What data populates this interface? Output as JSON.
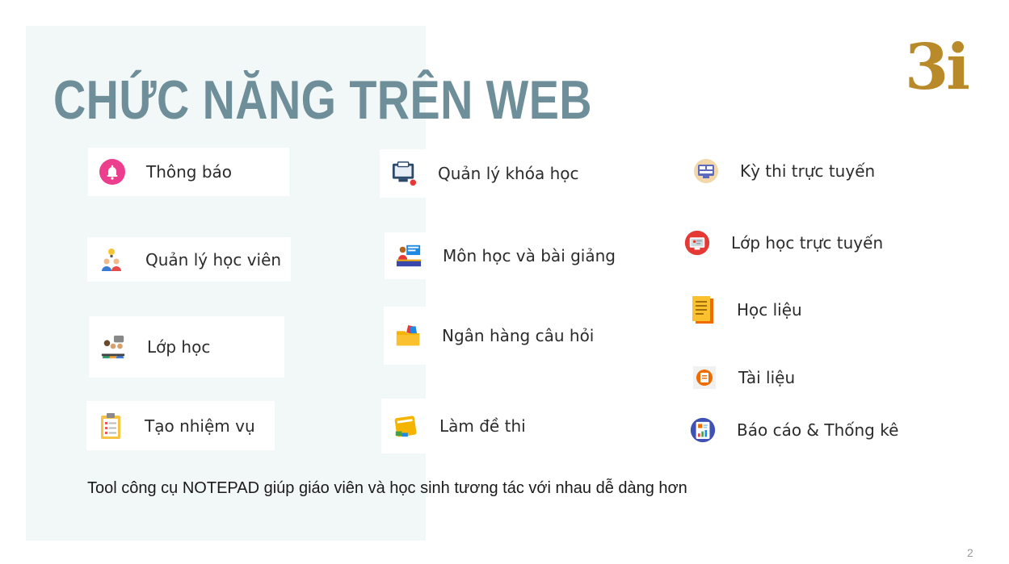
{
  "slide": {
    "title": "CHỨC NĂNG TRÊN WEB",
    "logo_text": "3i",
    "footer_note": "Tool công cụ NOTEPAD giúp giáo viên và học sinh tương tác với nhau dễ dàng hơn",
    "page_number": "2"
  },
  "features": [
    {
      "label": "Thông báo",
      "icon": "bell-icon"
    },
    {
      "label": "Quản lý học viên",
      "icon": "students-idea-icon"
    },
    {
      "label": "Lớp học",
      "icon": "classroom-icon"
    },
    {
      "label": "Tạo nhiệm vụ",
      "icon": "clipboard-icon"
    },
    {
      "label": "Quản lý khóa học",
      "icon": "monitor-course-icon"
    },
    {
      "label": "Môn học và bài giảng",
      "icon": "teacher-desk-icon"
    },
    {
      "label": "Ngân hàng câu hỏi",
      "icon": "folder-icon"
    },
    {
      "label": "Làm đề thi",
      "icon": "exam-pad-icon"
    },
    {
      "label": "Kỳ thi trực tuyến",
      "icon": "online-exam-icon"
    },
    {
      "label": "Lớp học trực tuyến",
      "icon": "online-class-icon"
    },
    {
      "label": "Học liệu",
      "icon": "document-stack-icon"
    },
    {
      "label": "Tài liệu",
      "icon": "document-badge-icon"
    },
    {
      "label": "Báo cáo & Thống kê",
      "icon": "report-chart-icon"
    }
  ],
  "colors": {
    "title": "#6e8e9a",
    "panel": "#f2f7f8",
    "logo_gold": "#b88a2a"
  }
}
